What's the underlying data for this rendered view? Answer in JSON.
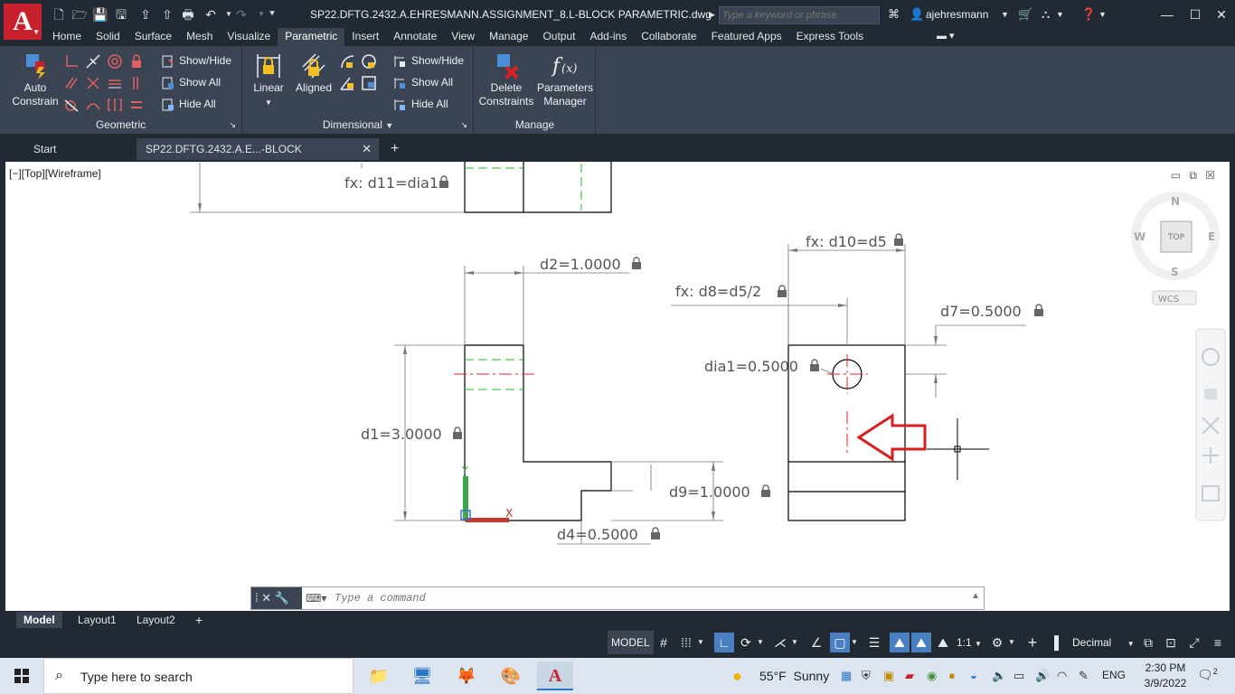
{
  "app": {
    "logo_letter": "A",
    "doc_title": "SP22.DFTG.2432.A.EHRESMANN.ASSIGNMENT_8.L-BLOCK PARAMETRIC.dwg",
    "search_placeholder": "Type a keyword or phrase",
    "user": "ajehresmann"
  },
  "menu_tabs": [
    "Home",
    "Solid",
    "Surface",
    "Mesh",
    "Visualize",
    "Parametric",
    "Insert",
    "Annotate",
    "View",
    "Manage",
    "Output",
    "Add-ins",
    "Collaborate",
    "Featured Apps",
    "Express Tools"
  ],
  "active_tab": "Parametric",
  "ribbon": {
    "geometric": {
      "title": "Geometric",
      "auto_constrain": "Auto Constrain",
      "show_hide": "Show/Hide",
      "show_all": "Show All",
      "hide_all": "Hide All"
    },
    "dimensional": {
      "title": "Dimensional",
      "linear": "Linear",
      "aligned": "Aligned",
      "show_hide": "Show/Hide",
      "show_all": "Show All",
      "hide_all": "Hide All"
    },
    "manage": {
      "title": "Manage",
      "delete_constraints": "Delete Constraints",
      "parameters_manager": "Parameters Manager"
    }
  },
  "file_tabs": {
    "start": "Start",
    "active": "SP22.DFTG.2432.A.E...-BLOCK PARAMETRIC*"
  },
  "viewport": {
    "label": "[−][Top][Wireframe]",
    "viewcube": {
      "n": "N",
      "s": "S",
      "e": "E",
      "w": "W",
      "top": "TOP",
      "wcs": "WCS"
    }
  },
  "dimensions": {
    "d11": "fx: d11=dia1",
    "d2": "d2=1.0000",
    "d1": "d1=3.0000",
    "d9": "d9=1.0000",
    "d4": "d4=0.5000",
    "d10": "fx: d10=d5",
    "d8": "fx: d8=d5/2",
    "d7": "d7=0.5000",
    "dia1": "dia1=0.5000"
  },
  "command_line": {
    "placeholder": "Type a command"
  },
  "layout_tabs": [
    "Model",
    "Layout1",
    "Layout2"
  ],
  "status_bar": {
    "model": "MODEL",
    "scale": "1:1",
    "units": "Decimal"
  },
  "taskbar": {
    "search": "Type here to search",
    "temperature": "55°F",
    "weather": "Sunny",
    "language": "ENG",
    "time": "2:30 PM",
    "date": "3/9/2022",
    "notifications": "2"
  },
  "colors": {
    "ribbon_bg": "#3b4453",
    "titlebar_bg": "#222933",
    "autocad_red": "#c8202c",
    "hidden_line": "#1fbf2a",
    "center_line": "#e02020",
    "arrow": "#d81e1e"
  }
}
